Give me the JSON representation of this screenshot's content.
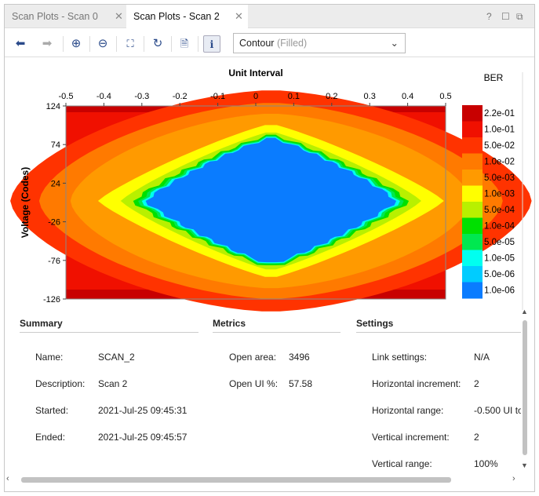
{
  "tabs": [
    {
      "label": "Scan Plots - Scan 0",
      "active": false
    },
    {
      "label": "Scan Plots - Scan 2",
      "active": true
    }
  ],
  "window_buttons": {
    "help": "?",
    "maximize": "☐",
    "float": "⧉"
  },
  "toolbar": {
    "icons": [
      "arrow-left-icon",
      "arrow-right-icon",
      "zoom-in-icon",
      "zoom-out-icon",
      "fit-icon",
      "refresh-icon",
      "export-icon",
      "info-icon"
    ],
    "plot_type": "Contour",
    "plot_type_suffix": "(Filled)"
  },
  "chart_data": {
    "type": "heatmap",
    "title": "Unit Interval",
    "xlabel": "Unit Interval",
    "ylabel": "Voltage (Codes)",
    "x_ticks": [
      "-0.5",
      "-0.4",
      "-0.3",
      "-0.2",
      "-0.1",
      "0",
      "0.1",
      "0.2",
      "0.3",
      "0.4",
      "0.5"
    ],
    "y_ticks": [
      "124",
      "74",
      "24",
      "-26",
      "-76",
      "-126"
    ],
    "xlim": [
      -0.5,
      0.5
    ],
    "ylim": [
      -126,
      124
    ],
    "legend_title": "BER",
    "legend": [
      {
        "label": "2.2e-01",
        "color": "#c80000"
      },
      {
        "label": "1.0e-01",
        "color": "#f01000"
      },
      {
        "label": "5.0e-02",
        "color": "#ff3300"
      },
      {
        "label": "1.0e-02",
        "color": "#ff7a00"
      },
      {
        "label": "5.0e-03",
        "color": "#ff9a00"
      },
      {
        "label": "1.0e-03",
        "color": "#ffff00"
      },
      {
        "label": "5.0e-04",
        "color": "#b8f000"
      },
      {
        "label": "1.0e-04",
        "color": "#00e000"
      },
      {
        "label": "5.0e-05",
        "color": "#00e850"
      },
      {
        "label": "1.0e-05",
        "color": "#00fff0"
      },
      {
        "label": "5.0e-06",
        "color": "#00ccff"
      },
      {
        "label": "1.0e-06",
        "color": "#0a7cff"
      }
    ],
    "eye": {
      "center_ui": 0.04,
      "center_code": 1,
      "left_ui": -0.28,
      "right_ui": 0.38,
      "top_code": 84,
      "bottom_code": -80
    }
  },
  "summary": {
    "title": "Summary",
    "rows": [
      {
        "label": "Name:",
        "value": "SCAN_2"
      },
      {
        "label": "Description:",
        "value": "Scan 2"
      },
      {
        "label": "Started:",
        "value": "2021-Jul-25 09:45:31"
      },
      {
        "label": "Ended:",
        "value": "2021-Jul-25 09:45:57"
      }
    ]
  },
  "metrics": {
    "title": "Metrics",
    "rows": [
      {
        "label": "Open area:",
        "value": "3496"
      },
      {
        "label": "Open UI %:",
        "value": "57.58"
      }
    ]
  },
  "settings": {
    "title": "Settings",
    "rows": [
      {
        "label": "Link settings:",
        "value": "N/A"
      },
      {
        "label": "Horizontal increment:",
        "value": "2"
      },
      {
        "label": "Horizontal range:",
        "value": "-0.500 UI to"
      },
      {
        "label": "Vertical increment:",
        "value": "2"
      },
      {
        "label": "Vertical range:",
        "value": "100%"
      }
    ]
  }
}
